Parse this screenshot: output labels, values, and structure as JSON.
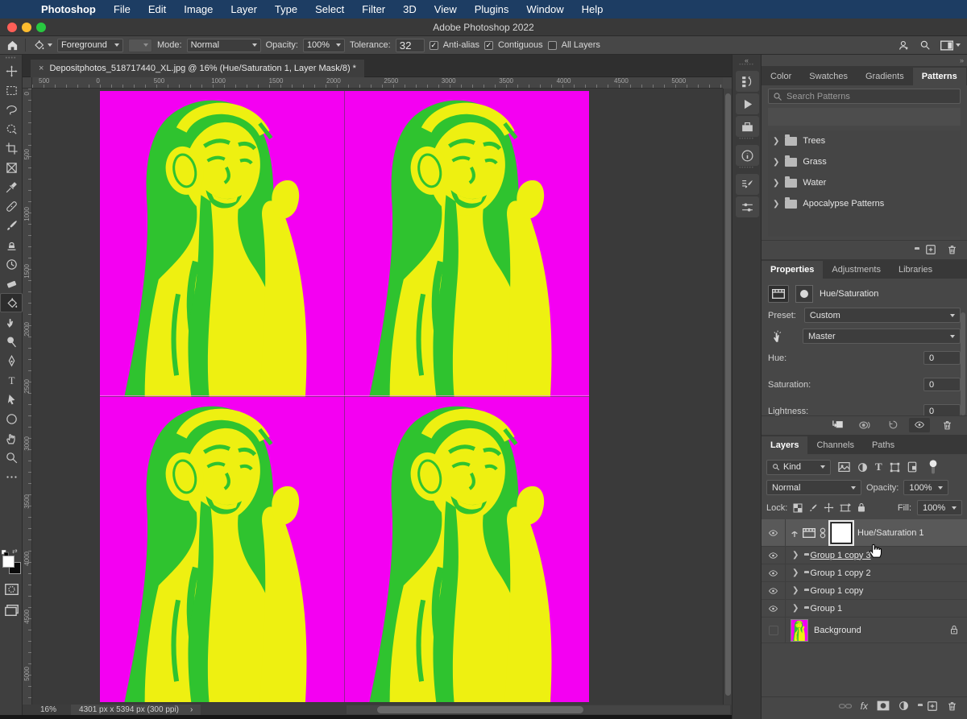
{
  "menu_bar": {
    "apple": "",
    "items": [
      "Photoshop",
      "File",
      "Edit",
      "Image",
      "Layer",
      "Type",
      "Select",
      "Filter",
      "3D",
      "View",
      "Plugins",
      "Window",
      "Help"
    ]
  },
  "title_bar": {
    "title": "Adobe Photoshop 2022"
  },
  "options_bar": {
    "fill_source_value": "Foreground",
    "mode_label": "Mode:",
    "mode_value": "Normal",
    "opacity_label": "Opacity:",
    "opacity_value": "100%",
    "tolerance_label": "Tolerance:",
    "tolerance_value": "32",
    "anti_alias_label": "Anti-alias",
    "anti_alias_checked": true,
    "contiguous_label": "Contiguous",
    "contiguous_checked": true,
    "all_layers_label": "All Layers",
    "all_layers_checked": false
  },
  "document": {
    "close_glyph": "×",
    "tab_title": "Depositphotos_518717440_XL.jpg @ 16% (Hue/Saturation 1, Layer Mask/8) *",
    "ruler_horizontal": [
      "500",
      "0",
      "500",
      "1000",
      "1500",
      "2000",
      "2500",
      "3000",
      "3500",
      "4000",
      "4500",
      "5000"
    ],
    "ruler_vertical": [
      "0",
      "500",
      "1000",
      "1500",
      "2000",
      "2500",
      "3000",
      "3500",
      "4000",
      "4500",
      "5000"
    ],
    "status_zoom": "16%",
    "status_info": "4301 px x 5394 px (300 ppi)",
    "status_chevron": "›"
  },
  "tools": [
    "move",
    "marquee",
    "lasso",
    "object-selection",
    "crop",
    "frame",
    "eyedropper",
    "healing-brush",
    "brush",
    "clone-stamp",
    "history-brush",
    "eraser",
    "paint-bucket",
    "smudge",
    "dodge",
    "pen",
    "type",
    "path-select",
    "shape",
    "hand",
    "zoom",
    "more"
  ],
  "tools_selected": "paint-bucket",
  "dock_icons": [
    "history",
    "actions",
    "libraries",
    "info",
    "brush-settings",
    "tool-presets"
  ],
  "panels": {
    "collapse_left": "«",
    "collapse_right": "»",
    "patterns": {
      "tabs": [
        "Color",
        "Swatches",
        "Gradients",
        "Patterns"
      ],
      "active_tab": "Patterns",
      "search_placeholder": "Search Patterns",
      "groups": [
        "Trees",
        "Grass",
        "Water",
        "Apocalypse Patterns"
      ]
    },
    "properties": {
      "tabs": [
        "Properties",
        "Adjustments",
        "Libraries"
      ],
      "active_tab": "Properties",
      "adjustment_title": "Hue/Saturation",
      "preset_label": "Preset:",
      "preset_value": "Custom",
      "channel_value": "Master",
      "hue_label": "Hue:",
      "hue_value": "0",
      "saturation_label": "Saturation:",
      "saturation_value": "0",
      "lightness_label": "Lightness:",
      "lightness_value": "0"
    },
    "layers": {
      "tabs": [
        "Layers",
        "Channels",
        "Paths"
      ],
      "active_tab": "Layers",
      "filter_value": "Kind",
      "blend_mode": "Normal",
      "opacity_label": "Opacity:",
      "opacity_value": "100%",
      "lock_label": "Lock:",
      "fill_label": "Fill:",
      "fill_value": "100%",
      "items": [
        {
          "name": "Hue/Saturation 1",
          "type": "adjustment",
          "selected": true,
          "visible": true
        },
        {
          "name": "Group 1 copy 3",
          "type": "group",
          "visible": true,
          "underlined": true
        },
        {
          "name": "Group 1 copy 2",
          "type": "group",
          "visible": true
        },
        {
          "name": "Group 1 copy",
          "type": "group",
          "visible": true
        },
        {
          "name": "Group 1",
          "type": "group",
          "visible": true
        },
        {
          "name": "Background",
          "type": "image",
          "visible": false,
          "locked": true
        }
      ]
    }
  },
  "colors": {
    "menubar_blue": "#1d3d63",
    "panel_gray": "#474747",
    "canvas_gray": "#3a3a3a",
    "art_magenta": "#f400f2",
    "art_green": "#2fc32f",
    "art_yellow": "#eef011",
    "traffic_red": "#ff5f57",
    "traffic_yellow": "#febc2e",
    "traffic_green": "#28c840"
  }
}
